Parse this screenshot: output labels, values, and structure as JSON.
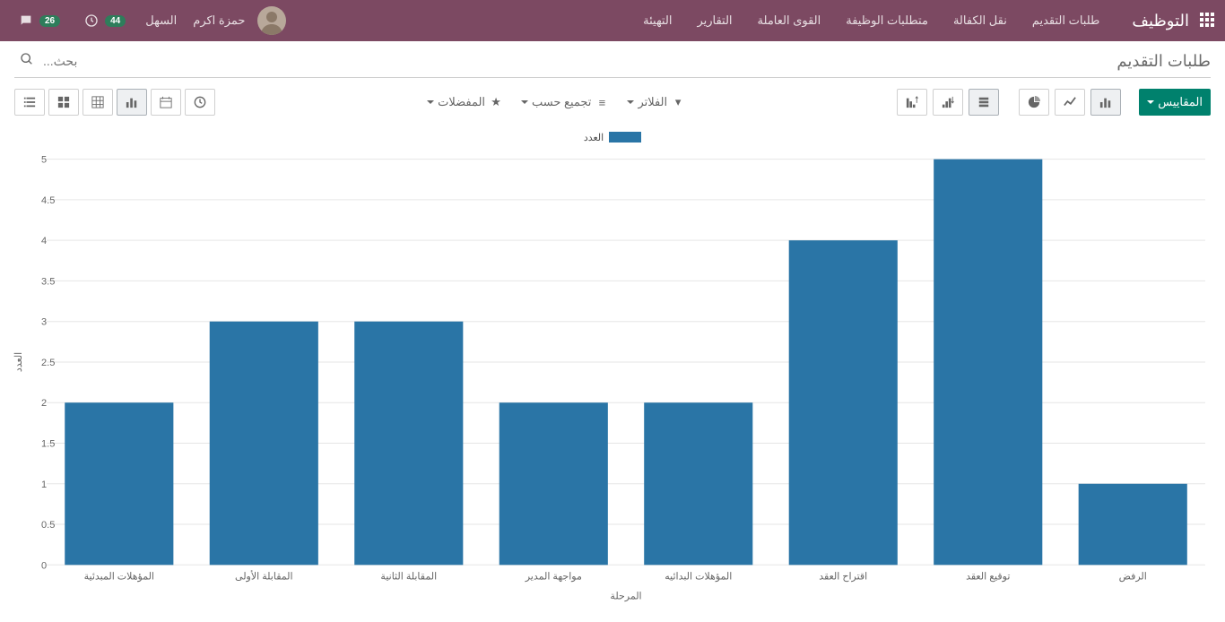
{
  "nav": {
    "app_title": "التوظيف",
    "items": [
      "طلبات التقديم",
      "نقل الكفالة",
      "متطلبات الوظيفة",
      "القوى العاملة",
      "التقارير",
      "التهيئة"
    ],
    "chat_badge": "26",
    "clock_badge": "44",
    "company": "السهل",
    "user": "حمزة اكرم"
  },
  "page": {
    "title": "طلبات التقديم",
    "search_placeholder": "بحث..."
  },
  "ctrl": {
    "measures": "المقاييس",
    "filters": "الفلاتر",
    "groupby": "تجميع حسب",
    "favorites": "المفضلات"
  },
  "chart_data": {
    "type": "bar",
    "legend": "العدد",
    "xlabel": "المرحلة",
    "ylabel": "العدد",
    "ylim": [
      0,
      5
    ],
    "ystep": 0.5,
    "categories": [
      "المؤهلات المبدئية",
      "المقابلة الأولى",
      "المقابلة الثانية",
      "مواجهة المدير",
      "المؤهلات البدائيه",
      "اقتراح العقد",
      "توقيع العقد",
      "الرفض"
    ],
    "values": [
      2,
      3,
      3,
      2,
      2,
      4,
      5,
      1
    ]
  }
}
